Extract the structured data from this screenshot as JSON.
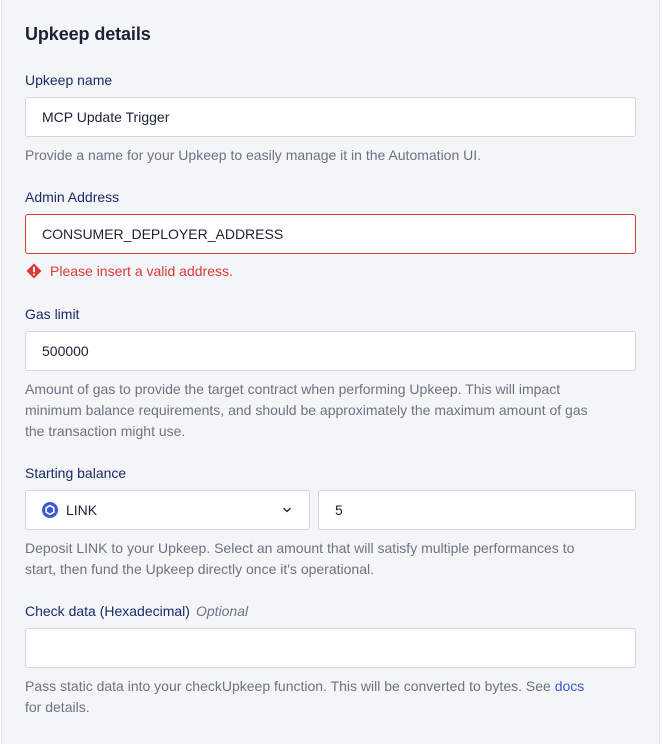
{
  "section": {
    "title": "Upkeep details"
  },
  "upkeep_name": {
    "label": "Upkeep name",
    "value": "MCP Update Trigger",
    "help": "Provide a name for your Upkeep to easily manage it in the Automation UI."
  },
  "admin_address": {
    "label": "Admin Address",
    "value": "CONSUMER_DEPLOYER_ADDRESS",
    "error": "Please insert a valid address."
  },
  "gas_limit": {
    "label": "Gas limit",
    "value": "500000",
    "help_line1": "Amount of gas to provide the target contract when performing Upkeep. This will impact",
    "help_line2": "minimum balance requirements, and should be approximately the maximum amount of gas",
    "help_line3": "the transaction might use."
  },
  "starting_balance": {
    "label": "Starting balance",
    "token": "LINK",
    "amount": "5",
    "help_line1": "Deposit LINK to your Upkeep. Select an amount that will satisfy multiple performances to",
    "help_line2": "start, then fund the Upkeep directly once it's operational."
  },
  "check_data": {
    "label": "Check data (Hexadecimal)",
    "optional": "Optional",
    "value": "",
    "help_line1": "Pass static data into your checkUpkeep function. This will be converted to bytes. See",
    "help_link": "docs",
    "help_line2": "for details."
  },
  "colors": {
    "accent": "#375bd2",
    "error": "#d83a3a",
    "label": "#1a2b6b",
    "help": "#6c7384",
    "panel_bg": "#f4f5f7"
  },
  "icons": {
    "error": "exclamation-diamond-icon",
    "token": "link-token-icon",
    "dropdown": "chevron-down-icon"
  }
}
